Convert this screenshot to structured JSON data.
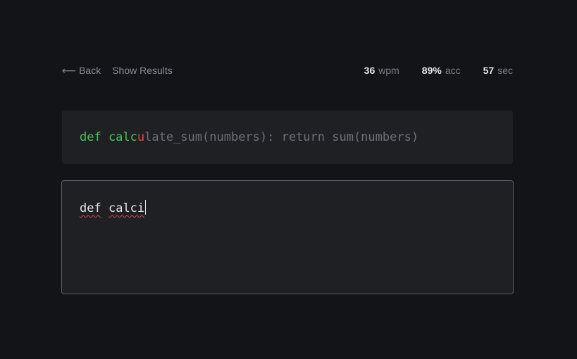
{
  "nav": {
    "back_arrow": "⟵",
    "back_label": "Back",
    "results_label": "Show Results"
  },
  "stats": {
    "wpm_value": "36",
    "wpm_unit": "wpm",
    "acc_value": "89%",
    "acc_unit": "acc",
    "time_value": "57",
    "time_unit": "sec"
  },
  "target": {
    "correct_text": "def calc",
    "error_char": "u",
    "remaining_text": "late_sum(numbers): return sum(numbers)"
  },
  "editor": {
    "word1": "def",
    "space": " ",
    "word2": "calci"
  },
  "colors": {
    "background": "#131417",
    "panel": "#1f2024",
    "correct": "#4cc25a",
    "error": "#e5484d",
    "pending": "#6e7077"
  }
}
